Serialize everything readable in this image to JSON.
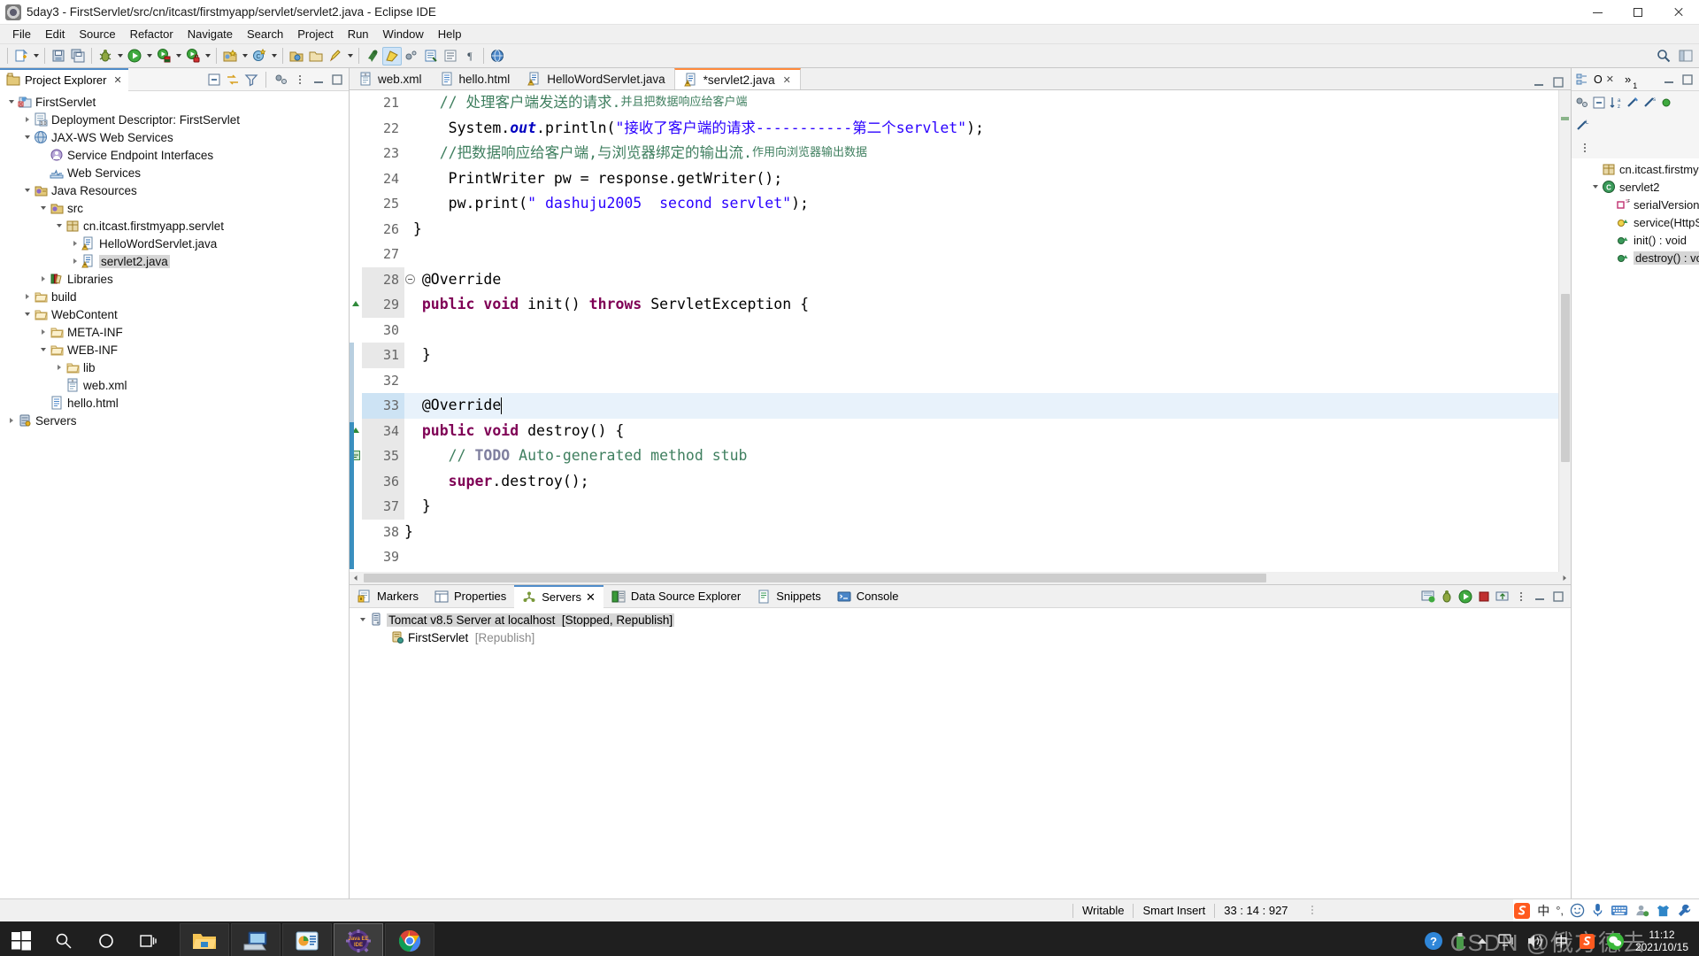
{
  "window": {
    "title": "5day3 - FirstServlet/src/cn/itcast/firstmyapp/servlet/servlet2.java - Eclipse IDE",
    "app_icon": "eclipse-icon",
    "minimize": "–",
    "maximize": "▢",
    "close": "✕"
  },
  "menubar": {
    "items": [
      "File",
      "Edit",
      "Source",
      "Refactor",
      "Navigate",
      "Search",
      "Project",
      "Run",
      "Window",
      "Help"
    ]
  },
  "toolbar": {
    "groups": [
      [
        "new-wizard-icon",
        "new-dropdown"
      ],
      [
        "save-icon",
        "save-all-icon"
      ],
      [
        "debug-icon",
        "debug-dropdown",
        "run-icon",
        "run-dropdown",
        "run-server-icon",
        "run-server-dropdown",
        "profile-icon",
        "profile-dropdown"
      ],
      [
        "new-java-project-icon",
        "new-java-project-dropdown",
        "new-class-icon",
        "new-class-dropdown"
      ],
      [
        "open-type-icon",
        "open-folder-icon",
        "quick-access-icon",
        "quick-access-dropdown"
      ],
      [
        "search-icon",
        "highlight-icon",
        "link-icon",
        "external-tools-icon",
        "toggle-block-icon",
        "show-whitespace-icon",
        "web-browser-icon"
      ]
    ],
    "right_icons": [
      "search-magnifier-icon",
      "perspective-icon"
    ]
  },
  "project_explorer": {
    "title": "Project Explorer",
    "close_glyph": "✕",
    "tools": [
      "collapse-all-icon",
      "link-with-editor-icon",
      "view-filter-icon",
      "focus-icon",
      "view-menu-icon",
      "minimize-icon",
      "maximize-icon"
    ],
    "tree": [
      {
        "label": "FirstServlet",
        "indent": 0,
        "twist": "expanded",
        "icon": "java-web-project-icon",
        "selected": false
      },
      {
        "label": "Deployment Descriptor: FirstServlet",
        "indent": 1,
        "twist": "collapsed",
        "icon": "deployment-descriptor-icon",
        "selected": false
      },
      {
        "label": "JAX-WS Web Services",
        "indent": 1,
        "twist": "expanded",
        "icon": "jaxws-icon",
        "selected": false
      },
      {
        "label": "Service Endpoint Interfaces",
        "indent": 2,
        "twist": "none",
        "icon": "endpoint-icon",
        "selected": false
      },
      {
        "label": "Web Services",
        "indent": 2,
        "twist": "none",
        "icon": "web-services-icon",
        "selected": false
      },
      {
        "label": "Java Resources",
        "indent": 1,
        "twist": "expanded",
        "icon": "java-resources-icon",
        "selected": false
      },
      {
        "label": "src",
        "indent": 2,
        "twist": "expanded",
        "icon": "source-folder-icon",
        "selected": false
      },
      {
        "label": "cn.itcast.firstmyapp.servlet",
        "indent": 3,
        "twist": "expanded",
        "icon": "package-icon",
        "selected": false
      },
      {
        "label": "HelloWordServlet.java",
        "indent": 4,
        "twist": "collapsed",
        "icon": "java-file-warning-icon",
        "selected": false
      },
      {
        "label": "servlet2.java",
        "indent": 4,
        "twist": "collapsed",
        "icon": "java-file-warning-icon",
        "selected": true
      },
      {
        "label": "Libraries",
        "indent": 2,
        "twist": "collapsed",
        "icon": "libraries-icon",
        "selected": false
      },
      {
        "label": "build",
        "indent": 1,
        "twist": "collapsed",
        "icon": "folder-icon",
        "selected": false
      },
      {
        "label": "WebContent",
        "indent": 1,
        "twist": "expanded",
        "icon": "folder-icon",
        "selected": false
      },
      {
        "label": "META-INF",
        "indent": 2,
        "twist": "collapsed",
        "icon": "folder-icon",
        "selected": false
      },
      {
        "label": "WEB-INF",
        "indent": 2,
        "twist": "expanded",
        "icon": "folder-icon",
        "selected": false
      },
      {
        "label": "lib",
        "indent": 3,
        "twist": "collapsed",
        "icon": "folder-icon",
        "selected": false
      },
      {
        "label": "web.xml",
        "indent": 3,
        "twist": "none",
        "icon": "xml-file-icon",
        "selected": false
      },
      {
        "label": "hello.html",
        "indent": 2,
        "twist": "none",
        "icon": "html-file-icon",
        "selected": false
      },
      {
        "label": "Servers",
        "indent": 0,
        "twist": "collapsed",
        "icon": "servers-project-icon",
        "selected": false
      }
    ]
  },
  "editor": {
    "tabs": [
      {
        "label": "web.xml",
        "icon": "xml-file-icon",
        "active": false,
        "dirty": false
      },
      {
        "label": "hello.html",
        "icon": "html-file-icon",
        "active": false,
        "dirty": false
      },
      {
        "label": "HelloWordServlet.java",
        "icon": "java-file-warning-icon",
        "active": false,
        "dirty": false
      },
      {
        "label": "*servlet2.java",
        "icon": "java-file-warning-icon",
        "active": true,
        "dirty": true
      }
    ],
    "active_close_glyph": "✕",
    "first_line": 21,
    "current_line": 33,
    "lines": [
      {
        "n": 21,
        "fold": "",
        "shaded": false,
        "marker": "",
        "segments": [
          {
            "t": "    ",
            "c": "plain"
          },
          {
            "t": "// 处理客户端发送的请求.",
            "c": "cmt"
          },
          {
            "t": "并且把数据响应给客户端",
            "c": "cmt-small"
          }
        ]
      },
      {
        "n": 22,
        "fold": "",
        "shaded": false,
        "marker": "",
        "segments": [
          {
            "t": "     System.",
            "c": "plain"
          },
          {
            "t": "out",
            "c": "fld"
          },
          {
            "t": ".println(",
            "c": "plain"
          },
          {
            "t": "\"接收了客户端的请求-----------第二个servlet\"",
            "c": "str"
          },
          {
            "t": ");",
            "c": "plain"
          }
        ]
      },
      {
        "n": 23,
        "fold": "",
        "shaded": false,
        "marker": "",
        "segments": [
          {
            "t": "    //把数据响应给客户端,与浏览器绑定的输出流.",
            "c": "cmt"
          },
          {
            "t": "作用向浏览器输出数据",
            "c": "cmt-small"
          }
        ]
      },
      {
        "n": 24,
        "fold": "",
        "shaded": false,
        "marker": "",
        "segments": [
          {
            "t": "     PrintWriter pw = response.getWriter();",
            "c": "plain"
          }
        ]
      },
      {
        "n": 25,
        "fold": "",
        "shaded": false,
        "marker": "",
        "segments": [
          {
            "t": "     pw.print(",
            "c": "plain"
          },
          {
            "t": "\" dashuju2005  second servlet\"",
            "c": "str"
          },
          {
            "t": ");",
            "c": "plain"
          }
        ]
      },
      {
        "n": 26,
        "fold": "",
        "shaded": false,
        "marker": "",
        "segments": [
          {
            "t": " }",
            "c": "plain"
          }
        ]
      },
      {
        "n": 27,
        "fold": "",
        "shaded": false,
        "marker": "",
        "segments": []
      },
      {
        "n": 28,
        "fold": "minus",
        "shaded": true,
        "marker": "",
        "segments": [
          {
            "t": "  @Override",
            "c": "plain"
          }
        ]
      },
      {
        "n": 29,
        "fold": "",
        "shaded": true,
        "marker": "up",
        "segments": [
          {
            "t": "  ",
            "c": "plain"
          },
          {
            "t": "public void ",
            "c": "kw"
          },
          {
            "t": "init() ",
            "c": "plain"
          },
          {
            "t": "throws ",
            "c": "kw"
          },
          {
            "t": "ServletException {",
            "c": "plain"
          }
        ]
      },
      {
        "n": 30,
        "fold": "",
        "shaded": false,
        "marker": "",
        "segments": []
      },
      {
        "n": 31,
        "fold": "",
        "shaded": true,
        "marker": "",
        "segments": [
          {
            "t": "  }",
            "c": "plain"
          }
        ]
      },
      {
        "n": 32,
        "fold": "",
        "shaded": false,
        "marker": "",
        "segments": []
      },
      {
        "n": 33,
        "fold": "minus",
        "shaded": false,
        "marker": "",
        "current": true,
        "segments": [
          {
            "t": "  @Override",
            "c": "plain"
          }
        ]
      },
      {
        "n": 34,
        "fold": "",
        "shaded": true,
        "marker": "up",
        "segments": [
          {
            "t": "  ",
            "c": "plain"
          },
          {
            "t": "public void ",
            "c": "kw"
          },
          {
            "t": "destroy() {",
            "c": "plain"
          }
        ]
      },
      {
        "n": 35,
        "fold": "",
        "shaded": true,
        "marker": "todo",
        "segments": [
          {
            "t": "     // ",
            "c": "cmt"
          },
          {
            "t": "TODO",
            "c": "task"
          },
          {
            "t": " Auto-generated method stub",
            "c": "cmt"
          }
        ]
      },
      {
        "n": 36,
        "fold": "",
        "shaded": true,
        "marker": "",
        "segments": [
          {
            "t": "     ",
            "c": "plain"
          },
          {
            "t": "super",
            "c": "kw"
          },
          {
            "t": ".destroy();",
            "c": "plain"
          }
        ]
      },
      {
        "n": 37,
        "fold": "",
        "shaded": true,
        "marker": "",
        "segments": [
          {
            "t": "  }",
            "c": "plain"
          }
        ]
      },
      {
        "n": 38,
        "fold": "",
        "shaded": false,
        "marker": "",
        "segments": [
          {
            "t": "}",
            "c": "plain"
          }
        ]
      },
      {
        "n": 39,
        "fold": "",
        "shaded": false,
        "marker": "",
        "segments": []
      }
    ]
  },
  "outline": {
    "tools": [
      "outline-view-icon",
      "outline-label",
      "close-icon",
      "chevron-more",
      "minimize-icon",
      "maximize-icon"
    ],
    "chevron_label": "»",
    "chevron_count": "1",
    "toolbar_icons": [
      "focus-icon",
      "collapse-all-icon",
      "sort-icon",
      "hide-fields-icon",
      "hide-static-icon",
      "hide-nonpublic-icon",
      "view-menu-icon"
    ],
    "items": [
      {
        "label": "cn.itcast.firstmya",
        "indent": 1,
        "icon": "package-icon",
        "twist": "none",
        "selected": false
      },
      {
        "label": "servlet2",
        "indent": 1,
        "icon": "class-icon",
        "twist": "expanded",
        "selected": false
      },
      {
        "label": "serialVersionU",
        "indent": 2,
        "icon": "static-final-field-icon",
        "twist": "none",
        "selected": false
      },
      {
        "label": "service(HttpS",
        "indent": 2,
        "icon": "protected-method-icon",
        "twist": "none",
        "selected": false
      },
      {
        "label": "init() : void",
        "indent": 2,
        "icon": "public-method-icon",
        "twist": "none",
        "selected": false
      },
      {
        "label": "destroy() : vo",
        "indent": 2,
        "icon": "public-method-icon",
        "twist": "none",
        "selected": true
      }
    ]
  },
  "bottom_panel": {
    "tabs": [
      {
        "label": "Markers",
        "icon": "markers-icon",
        "active": false
      },
      {
        "label": "Properties",
        "icon": "properties-icon",
        "active": false
      },
      {
        "label": "Servers",
        "icon": "servers-icon",
        "active": true
      },
      {
        "label": "Data Source Explorer",
        "icon": "datasource-icon",
        "active": false
      },
      {
        "label": "Snippets",
        "icon": "snippets-icon",
        "active": false
      },
      {
        "label": "Console",
        "icon": "console-icon",
        "active": false
      }
    ],
    "active_close_glyph": "✕",
    "tools": [
      "start-server-icon",
      "debug-server-icon",
      "run-server-icon",
      "stop-server-icon",
      "publish-icon",
      "view-menu-icon",
      "minimize-icon",
      "maximize-icon"
    ],
    "rows": [
      {
        "indent": 0,
        "twist": "expanded",
        "icon": "server-icon",
        "label": "Tomcat v8.5 Server at localhost",
        "status": "[Stopped, Republish]",
        "selected": true
      },
      {
        "indent": 1,
        "twist": "none",
        "icon": "module-icon",
        "label": "FirstServlet",
        "status": "[Republish]",
        "selected": false
      }
    ]
  },
  "statusbar": {
    "writable": "Writable",
    "insert_mode": "Smart Insert",
    "position": "33 : 14 : 927",
    "tray_lang": "中",
    "tray_icons": [
      "sogou-icon",
      "lang-cn-icon",
      "punctuation-icon",
      "emoji-icon",
      "microphone-icon",
      "keyboard-icon",
      "user-icon",
      "skin-icon",
      "toolbox-icon"
    ]
  },
  "taskbar": {
    "start": "windows-start-icon",
    "system_items": [
      "search-icon",
      "cortana-icon",
      "task-view-icon"
    ],
    "apps": [
      {
        "icon": "file-explorer-icon",
        "focused": false
      },
      {
        "icon": "remote-desktop-icon",
        "focused": false
      },
      {
        "icon": "powerpoint-icon",
        "focused": false
      },
      {
        "icon": "java-ee-ide-icon",
        "focused": true
      },
      {
        "icon": "chrome-icon",
        "focused": false
      }
    ],
    "tray": [
      "help-icon",
      "usb-icon",
      "show-hidden-icon",
      "network-icon",
      "volume-icon",
      "ime-cn-icon",
      "sogou-icon",
      "wechat-icon"
    ],
    "clock_time": "11:12",
    "clock_date": "2021/10/15",
    "watermark": "CSDN @俄方德去"
  },
  "colors": {
    "accent_tab": "#ff8a3c",
    "view_tab": "#4f8cc9",
    "keyword": "#7f0055",
    "string": "#2a00ff",
    "comment": "#3f7f5f",
    "field": "#0000c0",
    "selection": "#d6d6d6",
    "current_line": "#e8f2fb"
  }
}
